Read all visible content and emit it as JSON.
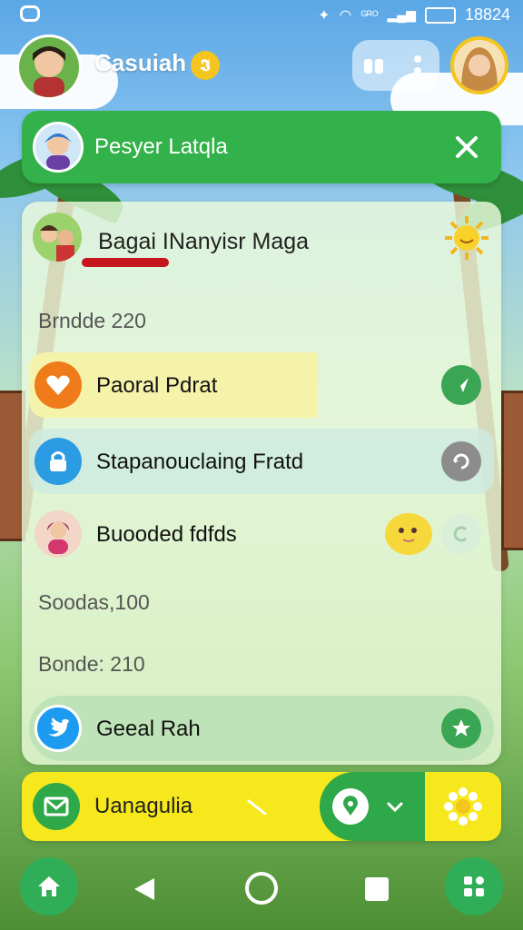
{
  "status_bar": {
    "time": "18824",
    "carrier": "ᴳᴿᴼ"
  },
  "header": {
    "title": "Casuiah",
    "coin_glyph": "𝕴"
  },
  "banner": {
    "label": "Pesyer Latqla"
  },
  "card": {
    "head_title": "Bagai INanyisr Maga",
    "section1_label": "Brndde 220",
    "rows": [
      {
        "label": "Paoral Pdrat",
        "color": "#f07b1a"
      },
      {
        "label": "Stapanouclaing Fratd",
        "color": "#2b9be3"
      },
      {
        "label": "Buooded fdfds",
        "color": "#f2d6c8"
      }
    ],
    "section2_label": "Soodas,100",
    "section3_label": "Bonde: 210",
    "featured_row": {
      "label": "Geeal Rah",
      "color": "#1d9bf0"
    }
  },
  "action_bar": {
    "label": "Uanagulia"
  },
  "colors": {
    "green": "#33b14a",
    "yellow": "#f6e81c",
    "red": "#c4161c"
  }
}
